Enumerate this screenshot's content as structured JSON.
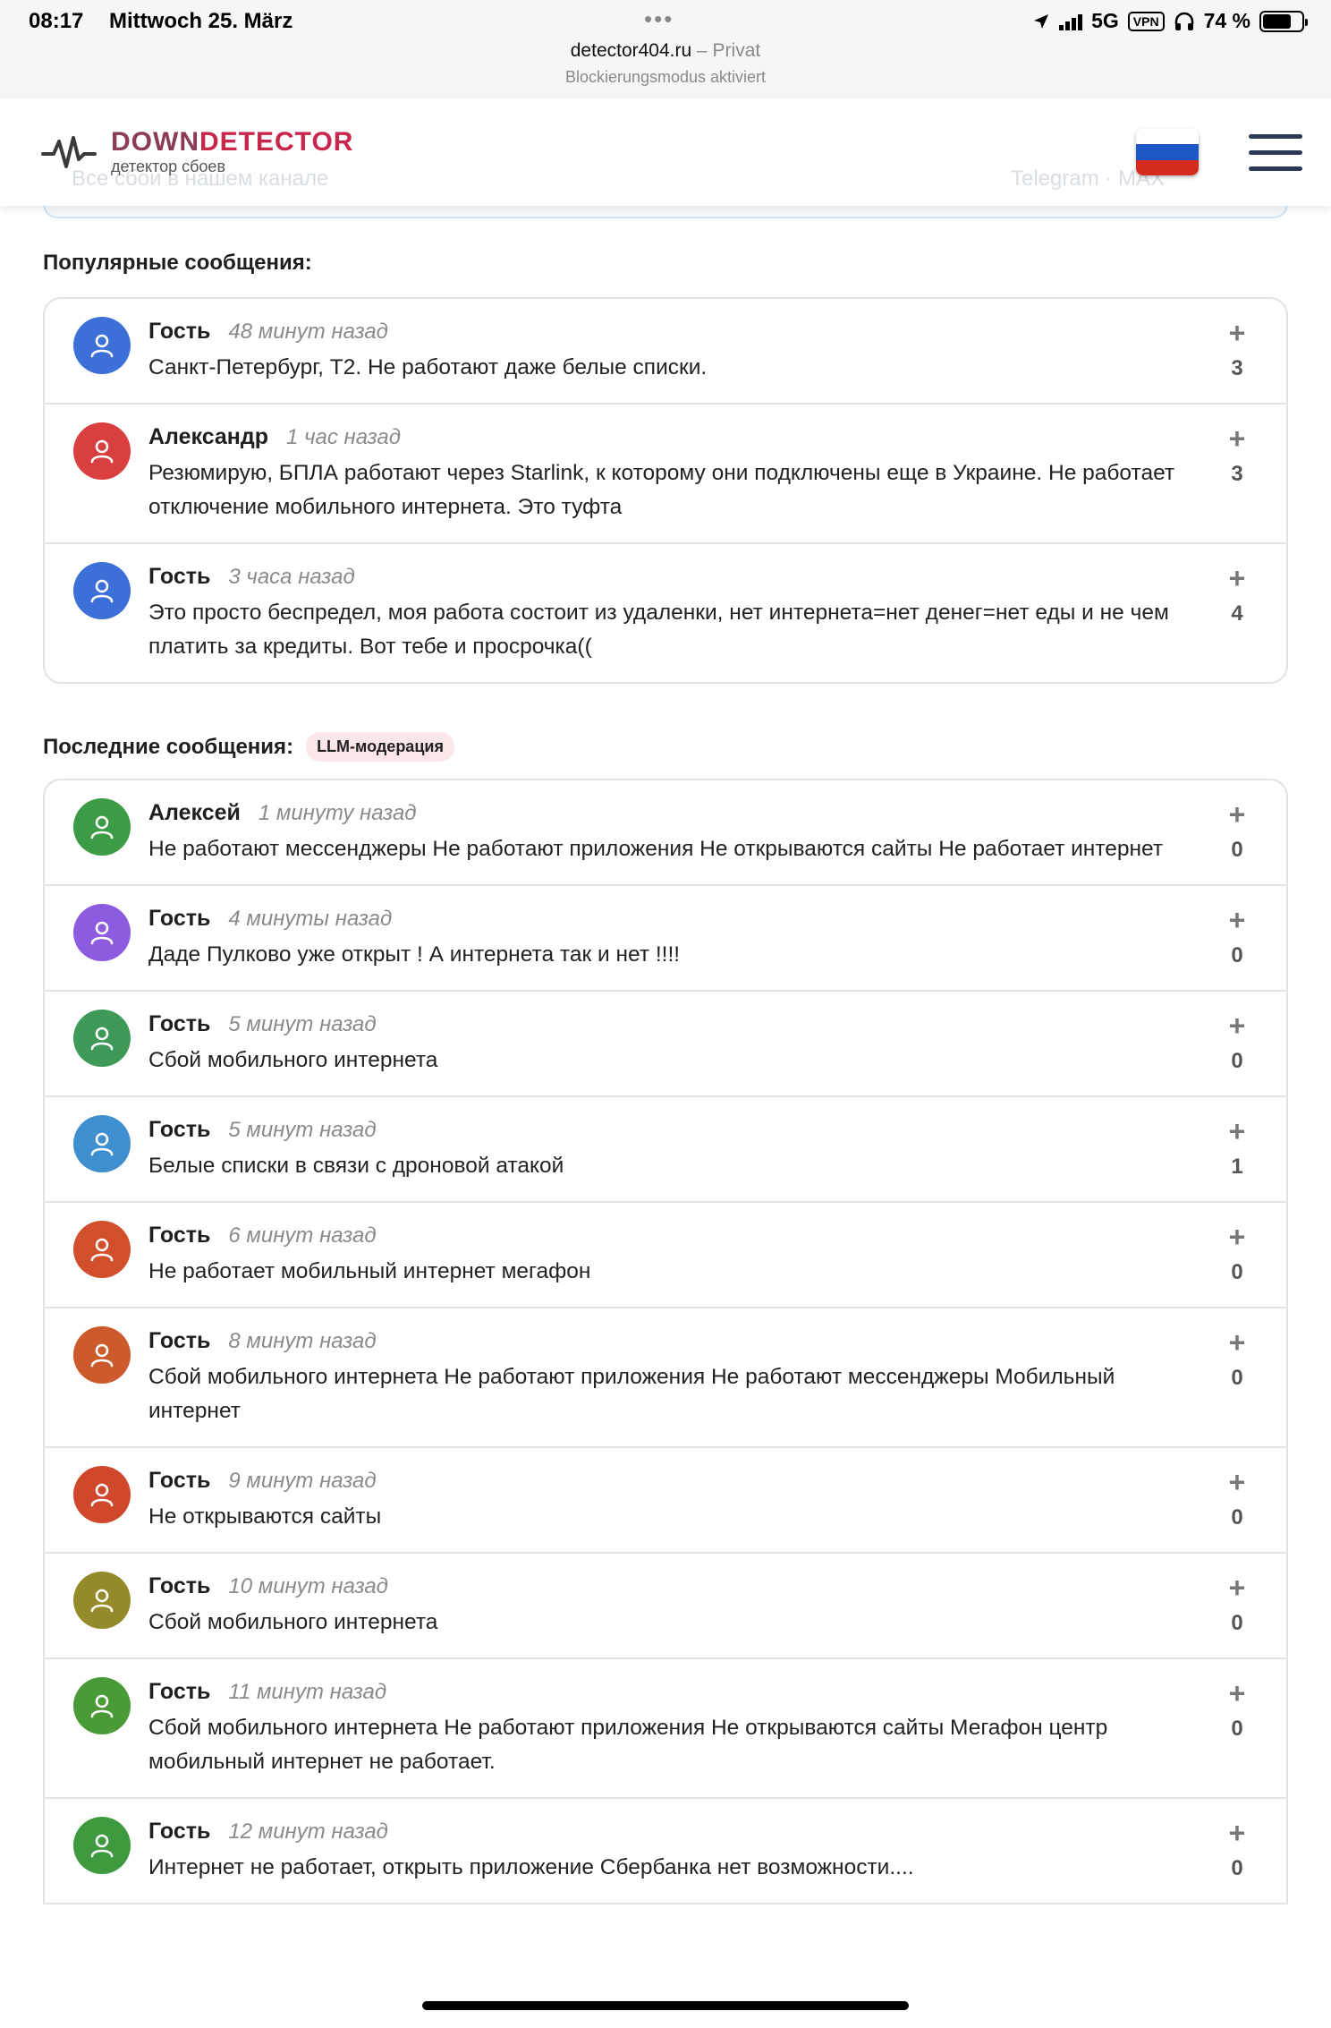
{
  "status_bar": {
    "time": "08:17",
    "date": "Mittwoch 25. März",
    "network": "5G",
    "vpn": "VPN",
    "battery": "74 %",
    "battery_level": 0.74,
    "url": "detector404.ru",
    "mode": "– Privat",
    "lockdown": "Blockierungsmodus aktiviert"
  },
  "header": {
    "logo_part1": "DOWN",
    "logo_part2": "DETECTOR",
    "logo_subtitle": "детектор сбоев",
    "behind_text": "Все сбои в нашем канале",
    "behind_links": "Telegram · MAX",
    "flag_colors": [
      "#ffffff",
      "#1c57c4",
      "#d52b1e"
    ]
  },
  "popular": {
    "title": "Популярные сообщения:",
    "messages": [
      {
        "author": "Гость",
        "time": "48 минут назад",
        "text": "Санкт-Петербург, Т2. Не работают даже белые списки.",
        "votes": "3",
        "color": "#3d6fd8"
      },
      {
        "author": "Александр",
        "time": "1 час назад",
        "text": "Резюмирую, БПЛА работают через Starlink, к которому они подключены еще в Украине. Не работает отключение мобильного интернета. Это туфта",
        "votes": "3",
        "color": "#d93f3f"
      },
      {
        "author": "Гость",
        "time": "3 часа назад",
        "text": "Это просто беспредел, моя работа состоит из удаленки, нет интернета=нет денег=нет еды и не чем платить за кредиты. Вот тебе и просрочка((",
        "votes": "4",
        "color": "#3d6fd8"
      }
    ]
  },
  "latest": {
    "title": "Последние сообщения:",
    "tag": "LLM-модерация",
    "messages": [
      {
        "author": "Алексей",
        "time": "1 минуту назад",
        "text": "Не работают мессенджеры Не работают приложения Не открываются сайты Не работает интернет",
        "votes": "0",
        "color": "#3c9b45"
      },
      {
        "author": "Гость",
        "time": "4 минуты назад",
        "text": "Даде Пулково уже открыт ! А интернета так и нет !!!!",
        "votes": "0",
        "color": "#8d5be0"
      },
      {
        "author": "Гость",
        "time": "5 минут назад",
        "text": "Сбой мобильного интернета",
        "votes": "0",
        "color": "#3f9a5a"
      },
      {
        "author": "Гость",
        "time": "5 минут назад",
        "text": "Белые списки в связи с дроновой атакой",
        "votes": "1",
        "color": "#3f8fd0"
      },
      {
        "author": "Гость",
        "time": "6 минут назад",
        "text": "Не работает мобильный интернет мегафон",
        "votes": "0",
        "color": "#d1502b"
      },
      {
        "author": "Гость",
        "time": "8 минут назад",
        "text": "Сбой мобильного интернета Не работают приложения Не работают мессенджеры Мобильный интернет",
        "votes": "0",
        "color": "#cc5a2c"
      },
      {
        "author": "Гость",
        "time": "9 минут назад",
        "text": "Не открываются сайты",
        "votes": "0",
        "color": "#d0482c"
      },
      {
        "author": "Гость",
        "time": "10 минут назад",
        "text": "Сбой мобильного интернета",
        "votes": "0",
        "color": "#948a2a"
      },
      {
        "author": "Гость",
        "time": "11 минут назад",
        "text": "Сбой мобильного интернета Не работают приложения Не открываются сайты Мегафон центр мобильный интернет не работает.",
        "votes": "0",
        "color": "#4a9a37"
      },
      {
        "author": "Гость",
        "time": "12 минут назад",
        "text": "Интернет не работает, открыть приложение Сбербанка нет возможности....",
        "votes": "0",
        "color": "#3f9a3f"
      }
    ]
  },
  "icons": {
    "avatar": "user-icon",
    "vote": "plus-icon",
    "logo": "pulse-icon",
    "menu": "hamburger-icon",
    "location": "location-arrow-icon",
    "headphones": "headphones-icon"
  }
}
